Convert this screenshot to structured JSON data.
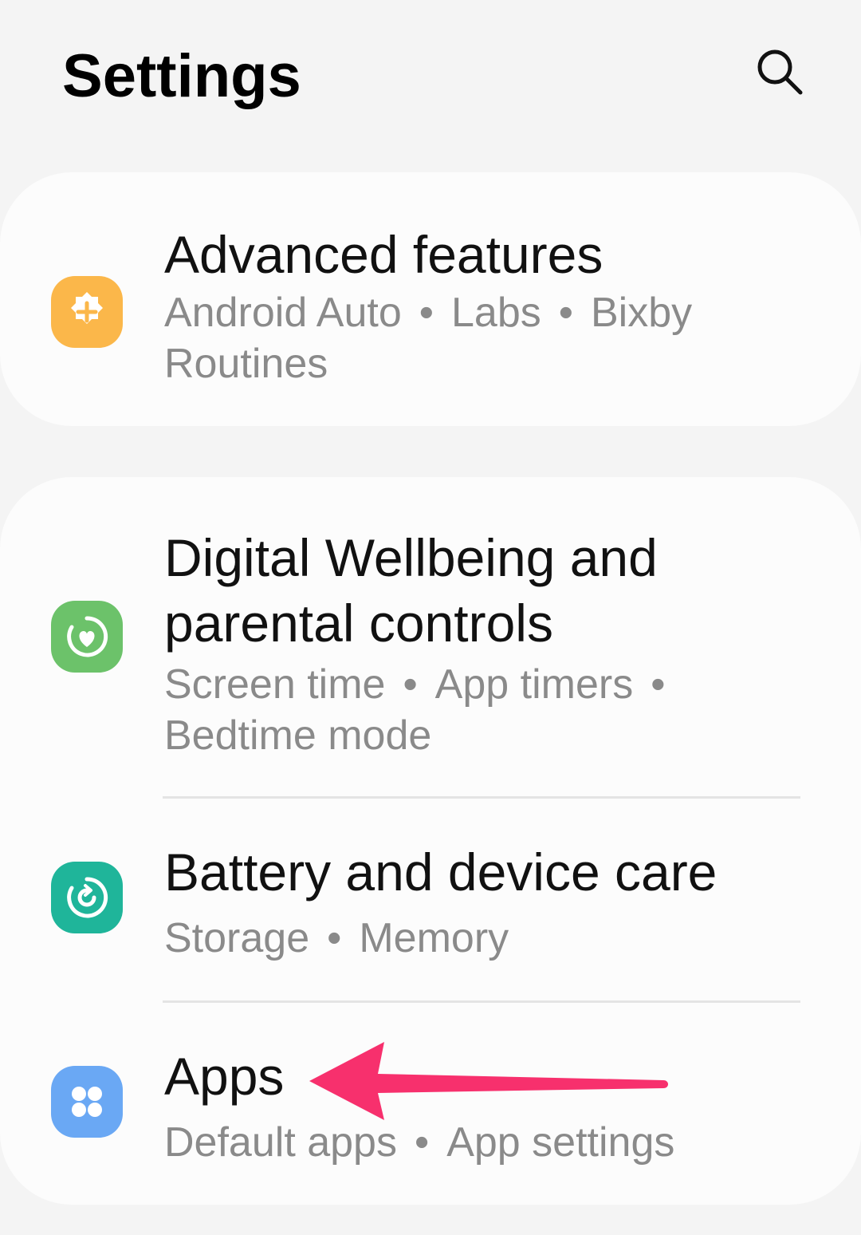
{
  "header": {
    "title": "Settings",
    "search_icon": "search-icon"
  },
  "items": [
    {
      "title": "Advanced features",
      "subtitle": [
        "Android Auto",
        "Labs",
        "Bixby Routines"
      ],
      "icon": "gear-plus-icon",
      "icon_color": "#fbb74a"
    },
    {
      "title": "Digital Wellbeing and parental controls",
      "subtitle": [
        "Screen time",
        "App timers",
        "Bedtime mode"
      ],
      "icon": "wellbeing-heart-icon",
      "icon_color": "#6cc26a"
    },
    {
      "title": "Battery and device care",
      "subtitle": [
        "Storage",
        "Memory"
      ],
      "icon": "device-care-icon",
      "icon_color": "#1fb59a"
    },
    {
      "title": "Apps",
      "subtitle": [
        "Default apps",
        "App settings"
      ],
      "icon": "apps-grid-icon",
      "icon_color": "#6aa8f4"
    }
  ],
  "annotation": {
    "arrow_icon": "pointer-arrow-icon",
    "arrow_color": "#f7306d"
  },
  "text": {
    "dot": "•"
  }
}
